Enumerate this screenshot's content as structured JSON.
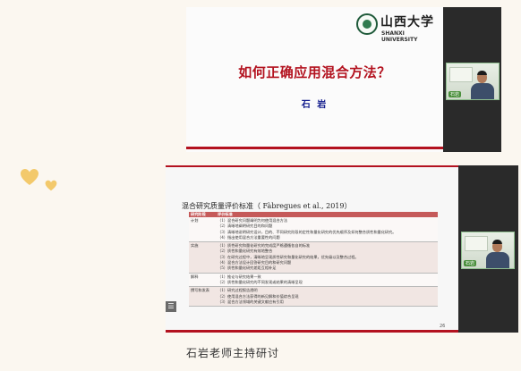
{
  "slide1": {
    "logo_text_zh": "山西大学",
    "logo_text_en": "SHANXI UNIVERSITY",
    "title": "如何正确应用混合方法？",
    "author": "石 岩"
  },
  "slide2": {
    "title": "混合研究质量评价标准（ Fàbregues et al., 2019）",
    "table_headers": [
      "研究阶段",
      "评价标准"
    ],
    "rows": [
      {
        "stage": "计划",
        "criteria": [
          "（1）混合研究问题阐明为何使用混合方法",
          "（2）清晰地阐明研究目的和问题",
          "（3）清晰地说明研究设计，目的、不同研究阶段的定性和量化研究的优先顺序及如何整合质性和量化研究。",
          "（4）指出使用混合方法重要性的问题"
        ]
      },
      {
        "stage": "实施",
        "criteria": [
          "（1）质性研究和量化研究的完成度严格遵循各自的标准",
          "（2）质性和量化研究有效地整合",
          "（3）在研究过程中，清晰地呈现质性研究和量化研究的结果，优先级以及整合过程。",
          "（4）混合方法设计回答研究目的和研究问题",
          "（5）质性和量化研究差距互相补足"
        ]
      },
      {
        "stage": "解释",
        "criteria": [
          "（1）推论与研究结果一致",
          "（2）质性和量化研究的不同发现或结果的清晰呈现"
        ]
      },
      {
        "stage": "撰写和发表",
        "criteria": [
          "（1）研究过程报告透明",
          "（2）使用混合方法获得的新见解和价值综合呈现",
          "（3）混合方法领域的关键文献应有引用"
        ]
      }
    ],
    "page_number": "26"
  },
  "camera_tag": "石岩",
  "caption": "石岩老师主持研讨",
  "colors": {
    "accent_red": "#b3121f",
    "author_blue": "#101a8c",
    "table_header": "#c55a5a",
    "heart": "#f3c96b"
  }
}
